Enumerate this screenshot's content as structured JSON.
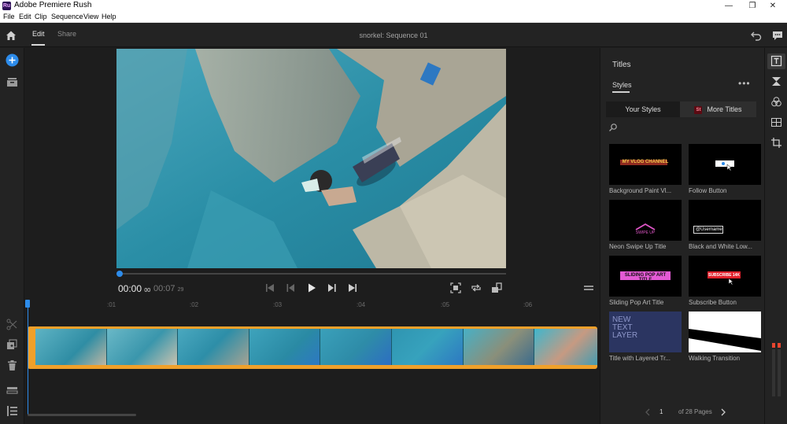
{
  "window": {
    "app_title": "Adobe Premiere Rush",
    "app_icon_text": "Ru",
    "minimize": "—",
    "restore": "❐",
    "close": "✕"
  },
  "menu": [
    "File",
    "Edit",
    "Clip",
    "Sequence",
    "View",
    "Help"
  ],
  "header": {
    "tabs": [
      {
        "label": "Edit",
        "active": true
      },
      {
        "label": "Share",
        "active": false
      }
    ],
    "sequence_title": "snorkel: Sequence 01"
  },
  "playback": {
    "current_time": "00:00",
    "current_frames": "00",
    "duration": "00:07",
    "duration_frames": "29"
  },
  "timeline": {
    "ticks": [
      ":01",
      ":02",
      ":03",
      ":04",
      ":05",
      ":06"
    ]
  },
  "panel": {
    "title": "Titles",
    "tab": "Styles",
    "more": "•••",
    "your_styles": "Your Styles",
    "more_titles_badge": "St",
    "more_titles": "More Titles",
    "tiles": [
      {
        "caption": "Background Paint Vl...",
        "art_text": "MY VLOG CHANNEL"
      },
      {
        "caption": "Follow Button",
        "art_text": ""
      },
      {
        "caption": "Neon Swipe Up Title",
        "art_text": "SWIPE UP"
      },
      {
        "caption": "Black and White Low...",
        "art_text": "@Username"
      },
      {
        "caption": "Sliding Pop Art Title",
        "art_text": "SLIDING POP ART TITLE"
      },
      {
        "caption": "Subscribe Button",
        "art_text": "SUBSCRIBE 14K"
      },
      {
        "caption": "Title with Layered Tr...",
        "art_text": "NEW TEXT LAYER"
      },
      {
        "caption": "Walking Transition",
        "art_text": ""
      }
    ],
    "pager": {
      "page": "1",
      "of_pages": "of 28 Pages"
    }
  },
  "colors": {
    "accent": "#2d8ceb",
    "clip_border": "#f0a02a",
    "water": "#2a8ea6"
  }
}
